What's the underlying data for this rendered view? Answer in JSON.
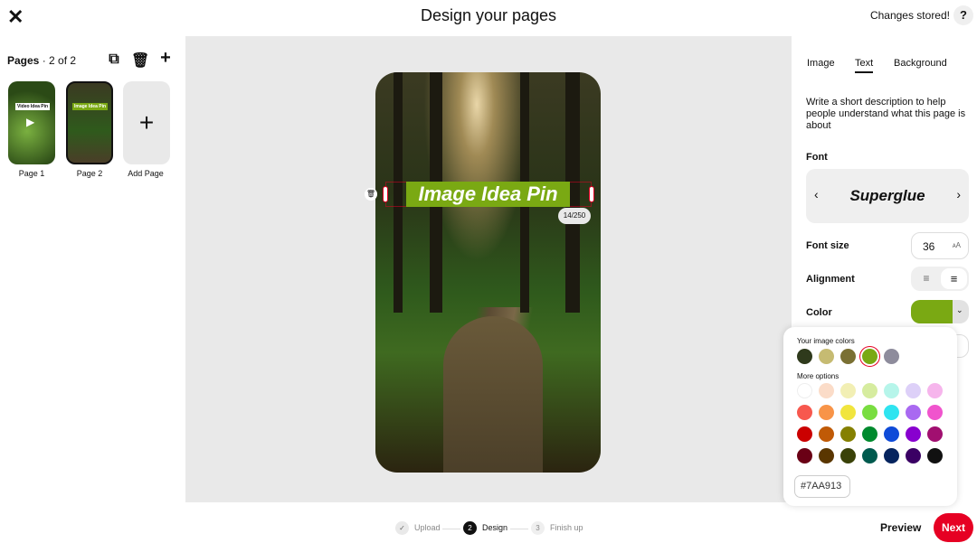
{
  "header": {
    "title": "Design your pages",
    "status": "Changes stored!",
    "help": "?"
  },
  "sidebar": {
    "pages_label": "Pages",
    "pages_count": "· 2 of 2",
    "pages": [
      {
        "label": "Page 1",
        "thumb_text": "Video Idea Pin"
      },
      {
        "label": "Page 2",
        "thumb_text": "Image Idea Pin"
      }
    ],
    "add_page": "Add Page"
  },
  "canvas": {
    "text": "Image Idea Pin",
    "counter": "14/250"
  },
  "panel": {
    "tabs": [
      "Image",
      "Text",
      "Background"
    ],
    "active_tab": "Text",
    "description": "Write a short description to help people understand what this page is about",
    "font_label": "Font",
    "font_name": "Superglue",
    "font_size_label": "Font size",
    "font_size": "36",
    "alignment_label": "Alignment",
    "color_label": "Color",
    "color": "#7AA913"
  },
  "color_popup": {
    "image_colors_label": "Your image colors",
    "image_colors": [
      "#2f3a1c",
      "#c6bb72",
      "#7a7033",
      "#7aa913",
      "#8e8c9c"
    ],
    "selected": "#7aa913",
    "more_label": "More options",
    "more_colors": [
      [
        "#ffffff",
        "#fbdcc8",
        "#f2efb4",
        "#d6ec9f",
        "#b6f5ea",
        "#ddd0f8",
        "#f6b5ec"
      ],
      [
        "#f7584e",
        "#f89448",
        "#f1e53e",
        "#79dd40",
        "#2fe4f0",
        "#a969f1",
        "#f054cd"
      ],
      [
        "#cb0000",
        "#c05a06",
        "#858000",
        "#008a2e",
        "#0f4bd8",
        "#8800cf",
        "#a10f70"
      ],
      [
        "#6a0015",
        "#5a3600",
        "#3a4208",
        "#005a4e",
        "#05245e",
        "#3a0064",
        "#111111"
      ]
    ],
    "hex_value": "#7AA913"
  },
  "footer": {
    "steps": [
      {
        "num": "✓",
        "label": "Upload"
      },
      {
        "num": "2",
        "label": "Design"
      },
      {
        "num": "3",
        "label": "Finish up"
      }
    ],
    "preview": "Preview",
    "next": "Next"
  }
}
